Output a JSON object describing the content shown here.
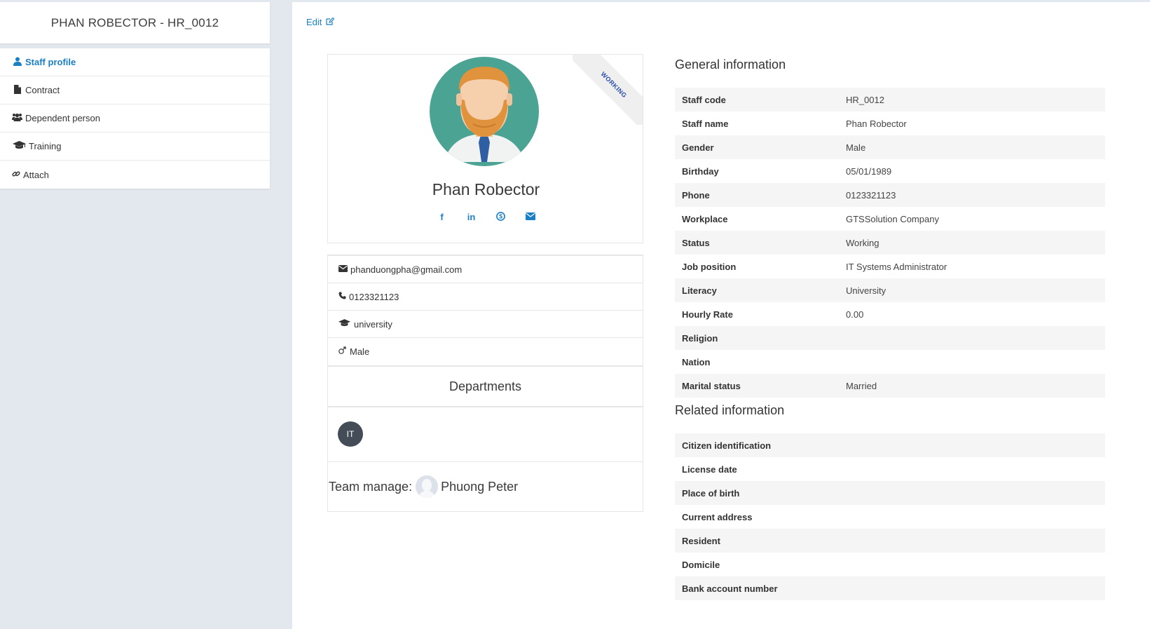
{
  "sidebar": {
    "header": "PHAN ROBECTOR - HR_0012",
    "items": [
      {
        "label": "Staff profile",
        "icon": "user-icon",
        "active": true
      },
      {
        "label": "Contract",
        "icon": "file-icon",
        "active": false
      },
      {
        "label": "Dependent person",
        "icon": "users-icon",
        "active": false
      },
      {
        "label": "Training",
        "icon": "graduation-cap-icon",
        "active": false
      },
      {
        "label": "Attach",
        "icon": "link-icon",
        "active": false
      }
    ]
  },
  "main": {
    "edit_label": "Edit",
    "profile": {
      "ribbon": "WORKING",
      "name": "Phan Robector",
      "socials": [
        "facebook-icon",
        "linkedin-icon",
        "skype-icon",
        "envelope-icon"
      ]
    },
    "contacts": {
      "email": "phanduongpha@gmail.com",
      "phone": "0123321123",
      "education": "university",
      "gender": "Male"
    },
    "departments": {
      "title": "Departments",
      "badge": "IT"
    },
    "team": {
      "label": "Team manage:",
      "manager": "Phuong Peter"
    },
    "general": {
      "title": "General information",
      "rows": [
        {
          "label": "Staff code",
          "value": "HR_0012"
        },
        {
          "label": "Staff name",
          "value": "Phan Robector"
        },
        {
          "label": "Gender",
          "value": "Male"
        },
        {
          "label": "Birthday",
          "value": "05/01/1989"
        },
        {
          "label": "Phone",
          "value": "0123321123"
        },
        {
          "label": "Workplace",
          "value": "GTSSolution Company"
        },
        {
          "label": "Status",
          "value": "Working"
        },
        {
          "label": "Job position",
          "value": "IT Systems Administrator"
        },
        {
          "label": "Literacy",
          "value": "University"
        },
        {
          "label": "Hourly Rate",
          "value": "0.00"
        },
        {
          "label": "Religion",
          "value": ""
        },
        {
          "label": "Nation",
          "value": ""
        },
        {
          "label": "Marital status",
          "value": "Married"
        }
      ]
    },
    "related": {
      "title": "Related information",
      "rows": [
        {
          "label": "Citizen identification",
          "value": ""
        },
        {
          "label": "License date",
          "value": ""
        },
        {
          "label": "Place of birth",
          "value": ""
        },
        {
          "label": "Current address",
          "value": ""
        },
        {
          "label": "Resident",
          "value": ""
        },
        {
          "label": "Domicile",
          "value": ""
        },
        {
          "label": "Bank account number",
          "value": ""
        }
      ]
    }
  }
}
